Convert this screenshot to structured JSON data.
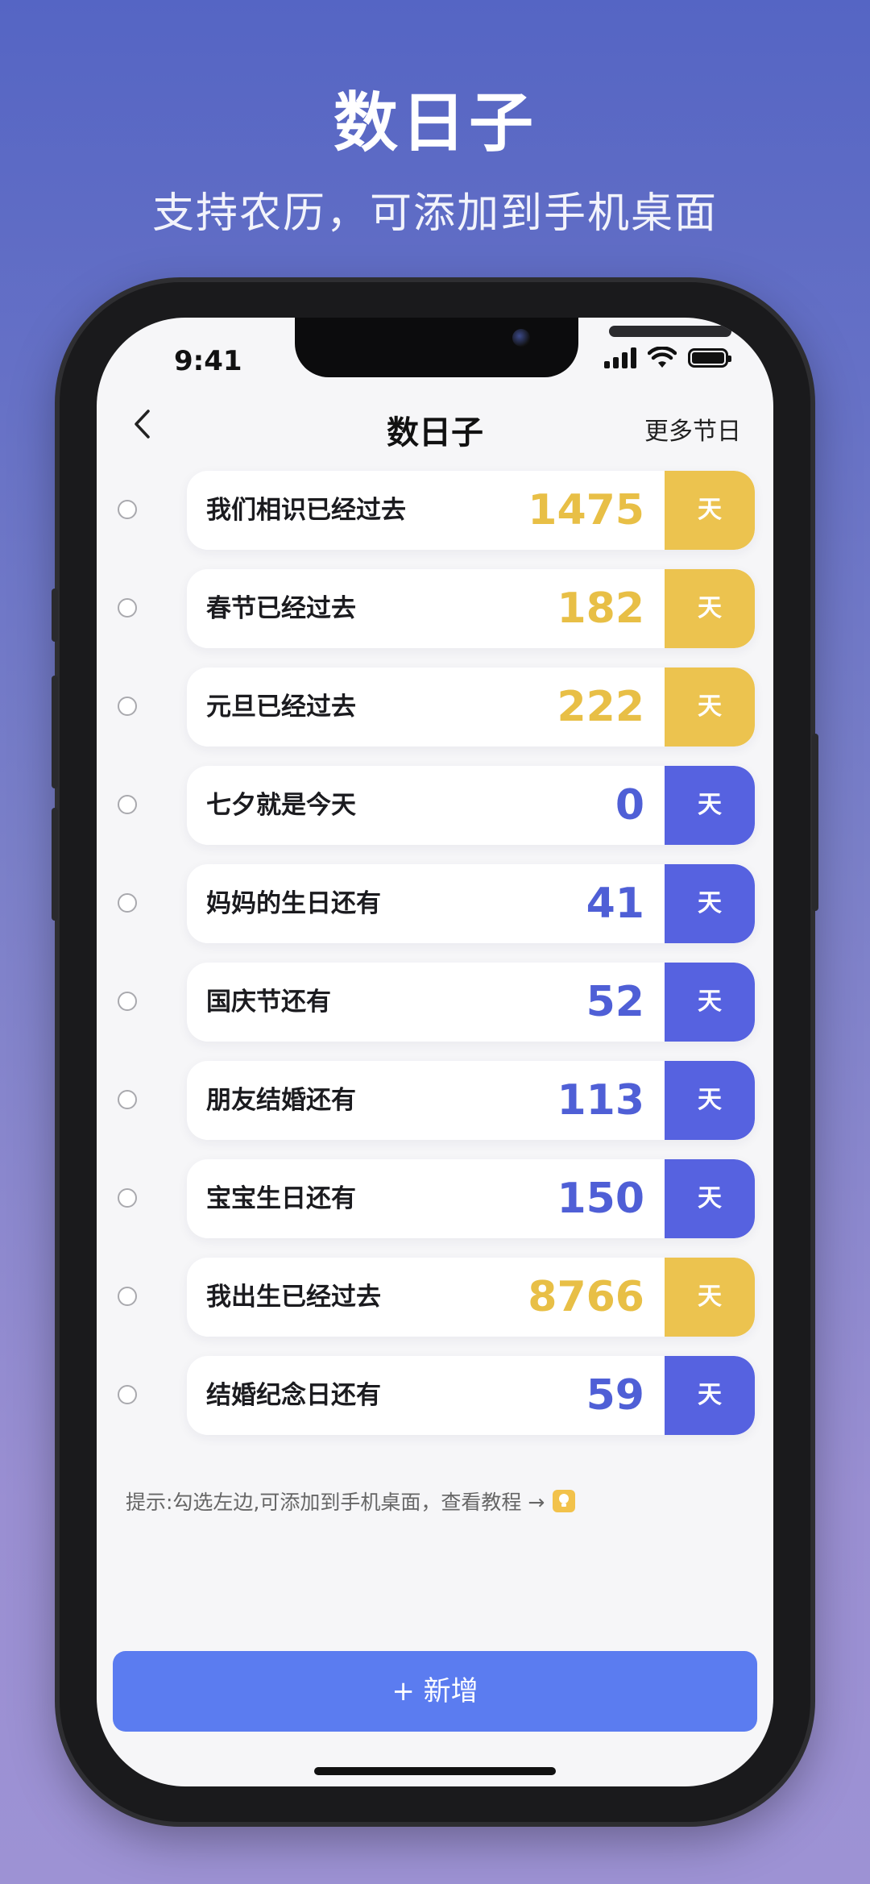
{
  "promo": {
    "headline": "数日子",
    "subline": "支持农历，可添加到手机桌面"
  },
  "status_bar": {
    "time": "9:41"
  },
  "nav": {
    "title": "数日子",
    "more_label": "更多节日"
  },
  "colors": {
    "passed": "#ecc34f",
    "passed_text": "#e8bf46",
    "upcoming": "#5662e0",
    "upcoming_text": "#4f5fd6",
    "add_button": "#5b7cf0"
  },
  "events": [
    {
      "label": "我们相识已经过去",
      "value": "1475",
      "unit": "天",
      "kind": "passed"
    },
    {
      "label": "春节已经过去",
      "value": "182",
      "unit": "天",
      "kind": "passed"
    },
    {
      "label": "元旦已经过去",
      "value": "222",
      "unit": "天",
      "kind": "passed"
    },
    {
      "label": "七夕就是今天",
      "value": "0",
      "unit": "天",
      "kind": "upcoming"
    },
    {
      "label": "妈妈的生日还有",
      "value": "41",
      "unit": "天",
      "kind": "upcoming"
    },
    {
      "label": "国庆节还有",
      "value": "52",
      "unit": "天",
      "kind": "upcoming"
    },
    {
      "label": "朋友结婚还有",
      "value": "113",
      "unit": "天",
      "kind": "upcoming"
    },
    {
      "label": "宝宝生日还有",
      "value": "150",
      "unit": "天",
      "kind": "upcoming"
    },
    {
      "label": "我出生已经过去",
      "value": "8766",
      "unit": "天",
      "kind": "passed"
    },
    {
      "label": "结婚纪念日还有",
      "value": "59",
      "unit": "天",
      "kind": "upcoming"
    }
  ],
  "tip": {
    "text": "提示:勾选左边,可添加到手机桌面，查看教程 →",
    "icon": "lightbulb-icon"
  },
  "add_button": {
    "label": "+ 新增"
  }
}
